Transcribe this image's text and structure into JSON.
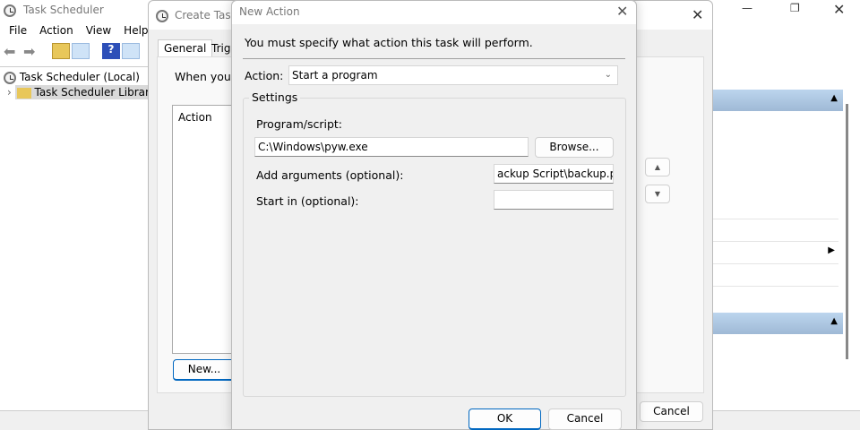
{
  "main": {
    "title": "Task Scheduler",
    "menu": [
      "File",
      "Action",
      "View",
      "Help"
    ],
    "tree": [
      {
        "label": "Task Scheduler (Local)"
      },
      {
        "label": "Task Scheduler Library"
      }
    ],
    "window_controls": [
      "minimize",
      "maximize",
      "close"
    ]
  },
  "create_task": {
    "title": "Create Task",
    "tabs": [
      "General",
      "Trigg"
    ],
    "intro": "When you c",
    "list_header": "Action",
    "new_button": "New...",
    "cancel_button": "Cancel"
  },
  "new_action": {
    "title": "New Action",
    "instruction": "You must specify what action this task will perform.",
    "action_label": "Action:",
    "action_value": "Start a program",
    "settings_label": "Settings",
    "program_label": "Program/script:",
    "program_value": "C:\\Windows\\pyw.exe",
    "browse_button": "Browse...",
    "args_label": "Add arguments (optional):",
    "args_value": "ackup Script\\backup.py\"",
    "startin_label": "Start in (optional):",
    "startin_value": "",
    "ok_button": "OK",
    "cancel_button": "Cancel"
  },
  "colors": {
    "dialog_bg": "#f0f0f0",
    "pane_header": "#a9c4e0",
    "accent": "#0067c0"
  }
}
